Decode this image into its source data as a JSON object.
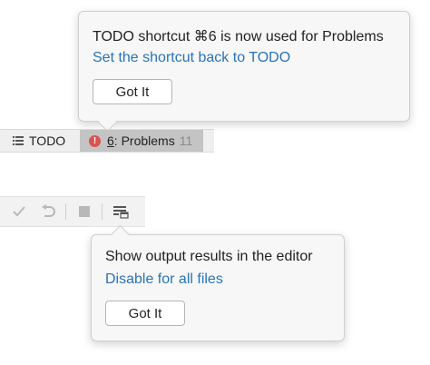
{
  "popup_todo": {
    "message": "TODO shortcut ⌘6 is now used for Problems",
    "link": "Set the shortcut back to TODO",
    "button": "Got It"
  },
  "tool_window_bar": {
    "todo_label": "TODO",
    "problems_mnemonic": "6",
    "problems_label": ": Problems",
    "problems_count": "11"
  },
  "action_toolbar": {
    "icons": [
      "check-icon",
      "undo-icon",
      "stop-icon",
      "output-editor-icon"
    ]
  },
  "popup_output": {
    "message": "Show output results in the editor",
    "link": "Disable for all files",
    "button": "Got It"
  },
  "colors": {
    "link": "#2a73b8",
    "error": "#d9534f",
    "selected_tab": "#c4c4c4"
  }
}
